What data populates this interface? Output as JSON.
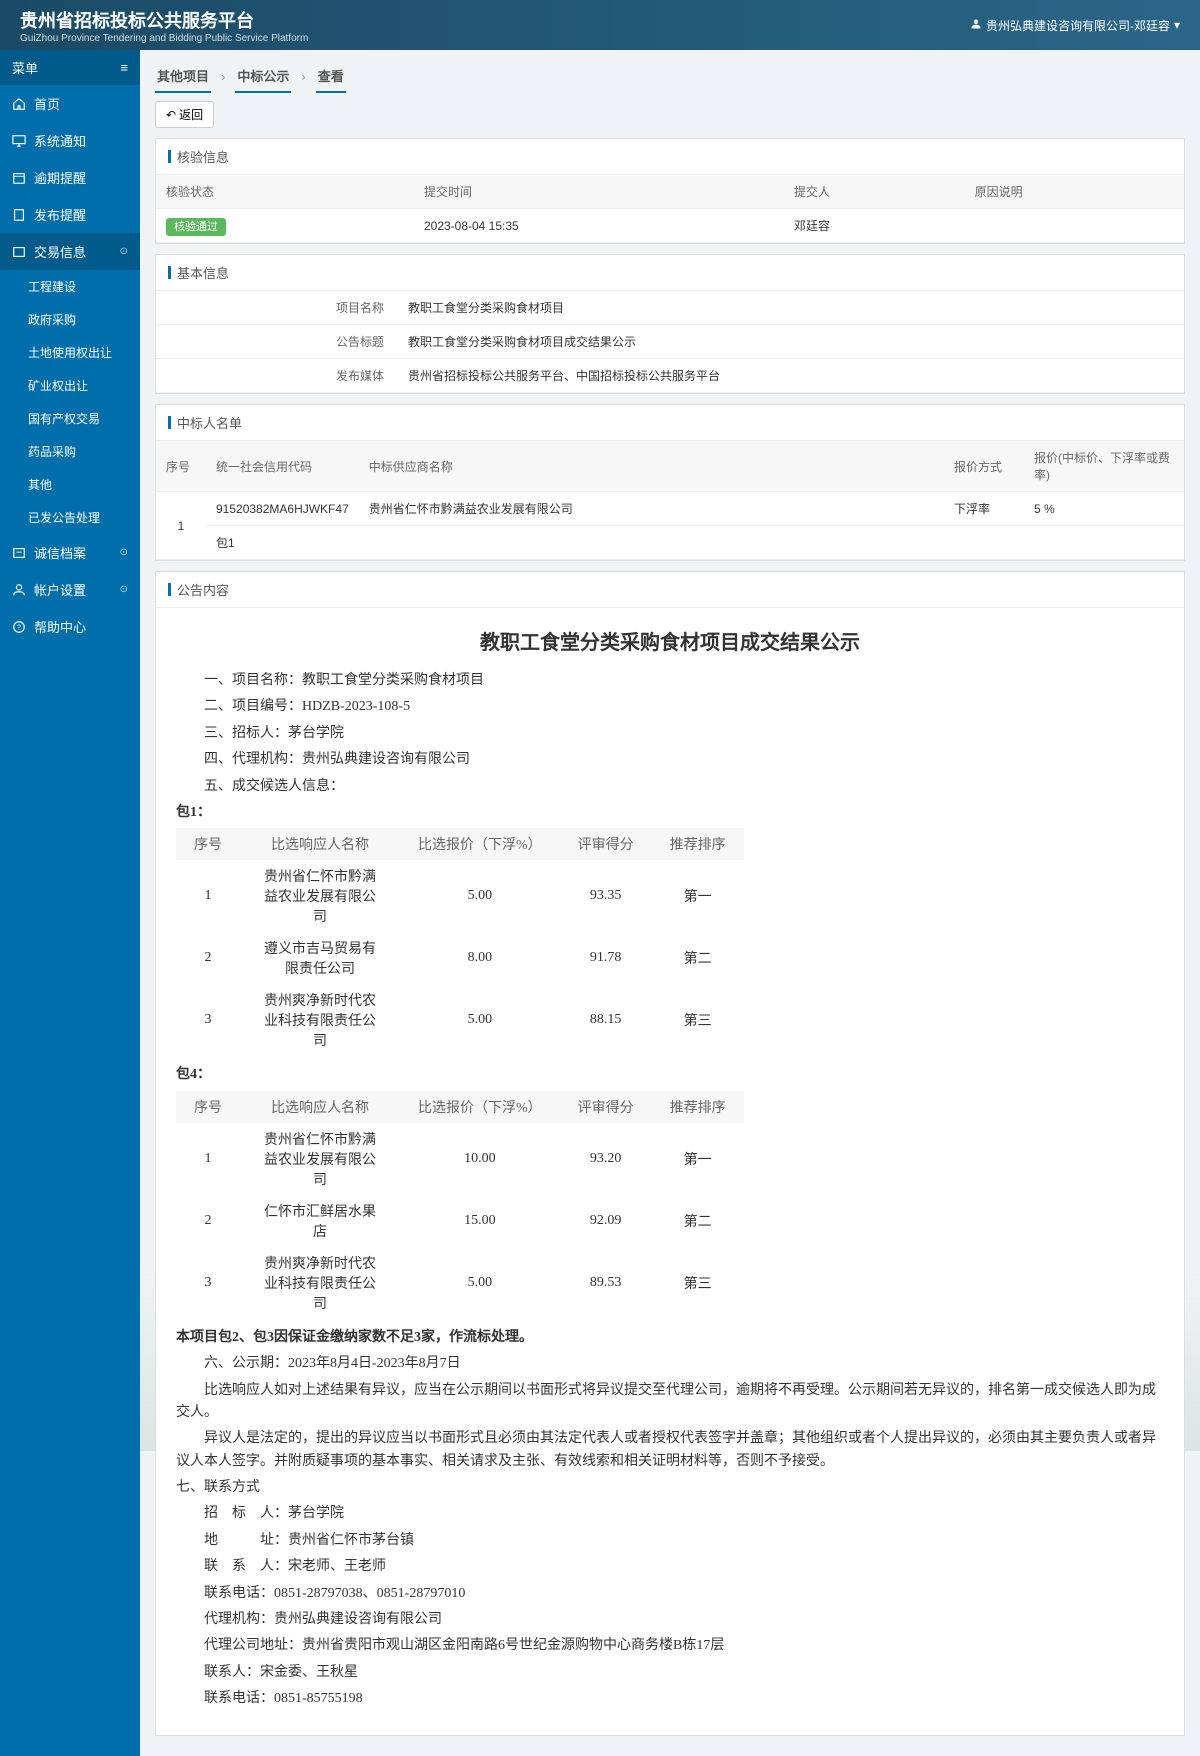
{
  "header": {
    "title": "贵州省招标投标公共服务平台",
    "subtitle": "GuiZhou Province Tendering and Bidding Public Service Platform",
    "user": "贵州弘典建设咨询有限公司-邓廷容"
  },
  "sidebar": {
    "menuLabel": "菜单",
    "items": [
      {
        "label": "首页"
      },
      {
        "label": "系统通知"
      },
      {
        "label": "逾期提醒"
      },
      {
        "label": "发布提醒"
      },
      {
        "label": "交易信息"
      },
      {
        "label": "诚信档案"
      },
      {
        "label": "帐户设置"
      },
      {
        "label": "帮助中心"
      }
    ],
    "sub": [
      "工程建设",
      "政府采购",
      "土地使用权出让",
      "矿业权出让",
      "国有产权交易",
      "药品采购",
      "其他",
      "已发公告处理"
    ]
  },
  "breadcrumb": [
    "其他项目",
    "中标公示",
    "查看"
  ],
  "backLabel": "返回",
  "panel1": {
    "title": "核验信息",
    "headers": [
      "核验状态",
      "提交时间",
      "提交人",
      "原因说明"
    ],
    "row": {
      "status": "核验通过",
      "time": "2023-08-04 15:35",
      "person": "邓廷容",
      "reason": ""
    }
  },
  "panel2": {
    "title": "基本信息",
    "rows": [
      {
        "label": "项目名称",
        "value": "教职工食堂分类采购食材项目"
      },
      {
        "label": "公告标题",
        "value": "教职工食堂分类采购食材项目成交结果公示"
      },
      {
        "label": "发布媒体",
        "value": "贵州省招标投标公共服务平台、中国招标投标公共服务平台"
      }
    ]
  },
  "panel3": {
    "title": "中标人名单",
    "headers": [
      "序号",
      "统一社会信用代码",
      "中标供应商名称",
      "报价方式",
      "报价(中标价、下浮率或费率)"
    ],
    "row": {
      "no": "1",
      "code": "91520382MA6HJWKF47",
      "name": "贵州省仁怀市黔满益农业发展有限公司",
      "method": "下浮率",
      "price": "5 %",
      "pkg": "包1"
    }
  },
  "content": {
    "panelTitle": "公告内容",
    "title": "教职工食堂分类采购食材项目成交结果公示",
    "lines1": [
      "一、项目名称：教职工食堂分类采购食材项目",
      "二、项目编号：HDZB-2023-108-5",
      "三、招标人：茅台学院",
      "四、代理机构：贵州弘典建设咨询有限公司",
      "五、成交候选人信息："
    ],
    "pkg1": {
      "label": "包1：",
      "headers": [
        "序号",
        "比选响应人名称",
        "比选报价（下浮%）",
        "评审得分",
        "推荐排序"
      ],
      "rows": [
        {
          "no": "1",
          "name": "贵州省仁怀市黔满益农业发展有限公司",
          "price": "5.00",
          "score": "93.35",
          "rank": "第一"
        },
        {
          "no": "2",
          "name": "遵义市吉马贸易有限责任公司",
          "price": "8.00",
          "score": "91.78",
          "rank": "第二"
        },
        {
          "no": "3",
          "name": "贵州爽净新时代农业科技有限责任公司",
          "price": "5.00",
          "score": "88.15",
          "rank": "第三"
        }
      ]
    },
    "pkg4": {
      "label": "包4：",
      "headers": [
        "序号",
        "比选响应人名称",
        "比选报价（下浮%）",
        "评审得分",
        "推荐排序"
      ],
      "rows": [
        {
          "no": "1",
          "name": "贵州省仁怀市黔满益农业发展有限公司",
          "price": "10.00",
          "score": "93.20",
          "rank": "第一"
        },
        {
          "no": "2",
          "name": "仁怀市汇鲜居水果店",
          "price": "15.00",
          "score": "92.09",
          "rank": "第二"
        },
        {
          "no": "3",
          "name": "贵州爽净新时代农业科技有限责任公司",
          "price": "5.00",
          "score": "89.53",
          "rank": "第三"
        }
      ]
    },
    "note": "本项目包2、包3因保证金缴纳家数不足3家，作流标处理。",
    "line6": "六、公示期：2023年8月4日-2023年8月7日",
    "para1": "比选响应人如对上述结果有异议，应当在公示期间以书面形式将异议提交至代理公司，逾期将不再受理。公示期间若无异议的，排名第一成交候选人即为成交人。",
    "para2": "异议人是法定的，提出的异议应当以书面形式且必须由其法定代表人或者授权代表签字并盖章；其他组织或者个人提出异议的，必须由其主要负责人或者异议人本人签字。并附质疑事项的基本事实、相关请求及主张、有效线索和相关证明材料等，否则不予接受。",
    "line7": "七、联系方式",
    "contacts": [
      "招　标　人：茅台学院",
      "地　　　址：贵州省仁怀市茅台镇",
      "联　系　人：宋老师、王老师",
      "联系电话：0851-28797038、0851-28797010",
      "代理机构：贵州弘典建设咨询有限公司",
      "代理公司地址：贵州省贵阳市观山湖区金阳南路6号世纪金源购物中心商务楼B栋17层",
      "联系人：宋金委、王秋星",
      "联系电话：0851-85755198"
    ]
  }
}
